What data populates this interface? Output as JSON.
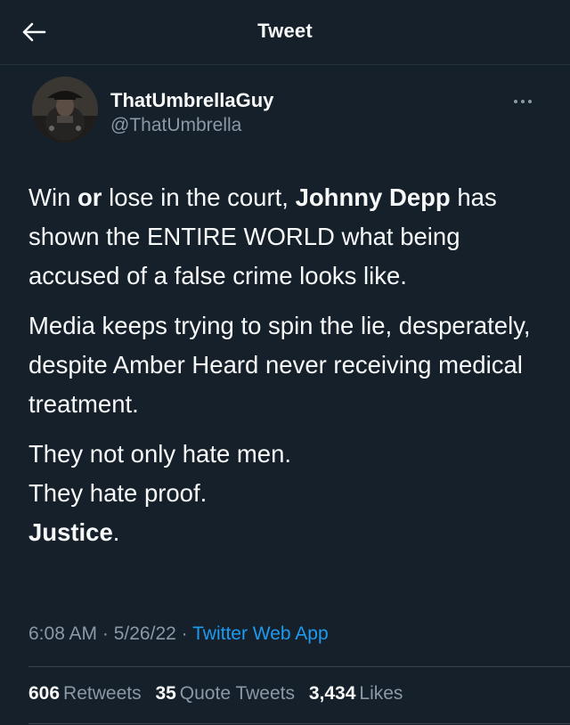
{
  "header": {
    "title": "Tweet",
    "back_icon": "arrow-left-icon"
  },
  "author": {
    "name": "ThatUmbrellaGuy",
    "handle": "@ThatUmbrella",
    "more_icon": "more-horizontal-icon"
  },
  "tweet": {
    "p1_a": "Win ",
    "p1_b": "or",
    "p1_c": " lose in the court, ",
    "p1_d": "Johnny Depp",
    "p1_e": " has shown the ENTIRE WORLD what being accused of a false crime looks like.",
    "p2": "Media keeps trying to spin the lie, desperately, despite Amber Heard never receiving medical treatment.",
    "p3_l1": "They not only hate men.",
    "p3_l2": "They hate proof.",
    "p3_l3_bold": "Justice",
    "p3_l3_end": "."
  },
  "meta": {
    "time": "6:08 AM",
    "sep1": " · ",
    "date": "5/26/22",
    "sep2": " · ",
    "source": "Twitter Web App"
  },
  "stats": [
    {
      "count": "606",
      "label": "Retweets"
    },
    {
      "count": "35",
      "label": "Quote Tweets"
    },
    {
      "count": "3,434",
      "label": "Likes"
    }
  ],
  "colors": {
    "background": "#15202b",
    "text": "#f7f9f9",
    "secondary": "#8b98a5",
    "accent": "#1d9bf0"
  }
}
